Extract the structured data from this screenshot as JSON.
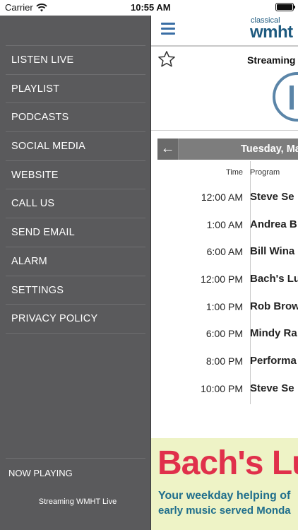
{
  "status_bar": {
    "carrier": "Carrier",
    "time": "10:55 AM"
  },
  "drawer": {
    "menu_items": [
      {
        "label": "LISTEN LIVE"
      },
      {
        "label": "PLAYLIST"
      },
      {
        "label": "PODCASTS"
      },
      {
        "label": "SOCIAL MEDIA"
      },
      {
        "label": "WEBSITE"
      },
      {
        "label": "CALL US"
      },
      {
        "label": "SEND EMAIL"
      },
      {
        "label": "ALARM"
      },
      {
        "label": "SETTINGS"
      },
      {
        "label": "PRIVACY POLICY"
      }
    ],
    "now_playing_label": "NOW PLAYING",
    "now_playing_station": "Streaming WMHT Live"
  },
  "header": {
    "logo_small": "classical",
    "logo_big": "wmht"
  },
  "player": {
    "title": "Streaming"
  },
  "schedule": {
    "day": "Tuesday, Ma",
    "back_label": "←",
    "col_time": "Time",
    "col_program": "Program",
    "rows": [
      {
        "time": "12:00 AM",
        "program": "Steve Se"
      },
      {
        "time": "1:00 AM",
        "program": "Andrea B"
      },
      {
        "time": "6:00 AM",
        "program": "Bill Wina"
      },
      {
        "time": "12:00 PM",
        "program": "Bach's Lu"
      },
      {
        "time": "1:00 PM",
        "program": "Rob Brow"
      },
      {
        "time": "6:00 PM",
        "program": "Mindy Ra"
      },
      {
        "time": "8:00 PM",
        "program": "Performa"
      },
      {
        "time": "10:00 PM",
        "program": "Steve Se"
      }
    ]
  },
  "ad": {
    "title": "Bach's Lu",
    "line1": "Your weekday helping of",
    "line2": "early music served Monda"
  },
  "colors": {
    "drawer_bg": "#5a5a5c",
    "accent_blue": "#3a6ea5",
    "logo_blue": "#1e5a7f",
    "ad_red": "#e0304b",
    "ad_bg": "#eef3c6"
  }
}
